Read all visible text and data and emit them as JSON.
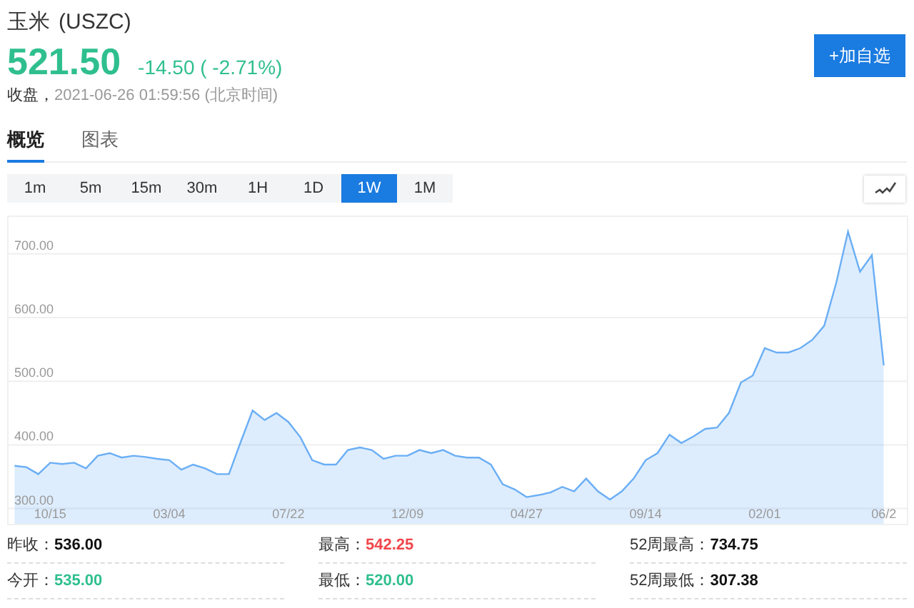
{
  "header": {
    "name": "玉米",
    "symbol": "(USZC)",
    "price": "521.50",
    "change": "-14.50 ( -2.71%)",
    "color": "#2fbf8f",
    "status": "收盘，",
    "timestamp": "2021-06-26 01:59:56 (北京时间)",
    "watchlist_button": "+加自选"
  },
  "tabs": [
    {
      "label": "概览",
      "selected": true
    },
    {
      "label": "图表",
      "selected": false
    }
  ],
  "periods": [
    {
      "label": "1m",
      "selected": false
    },
    {
      "label": "5m",
      "selected": false
    },
    {
      "label": "15m",
      "selected": false
    },
    {
      "label": "30m",
      "selected": false
    },
    {
      "label": "1H",
      "selected": false
    },
    {
      "label": "1D",
      "selected": false
    },
    {
      "label": "1W",
      "selected": true
    },
    {
      "label": "1M",
      "selected": false
    }
  ],
  "chart": {
    "chart_data": {
      "type": "area",
      "categories": [
        null,
        null,
        null,
        "10/15",
        null,
        null,
        null,
        null,
        null,
        null,
        null,
        null,
        null,
        "03/04",
        null,
        null,
        null,
        null,
        null,
        null,
        null,
        null,
        null,
        "07/22",
        null,
        null,
        null,
        null,
        null,
        null,
        null,
        null,
        null,
        "12/09",
        null,
        null,
        null,
        null,
        null,
        null,
        null,
        null,
        null,
        "04/27",
        null,
        null,
        null,
        null,
        null,
        null,
        null,
        null,
        null,
        "09/14",
        null,
        null,
        null,
        null,
        null,
        null,
        null,
        null,
        null,
        "02/01",
        null,
        null,
        null,
        null,
        null,
        null,
        null,
        null,
        null,
        "06/2"
      ],
      "series": [
        {
          "color": "#6aaef5",
          "values": [
            367,
            365,
            354,
            372,
            370,
            372,
            363,
            383,
            387,
            380,
            383,
            381,
            378,
            376,
            361,
            369,
            363,
            354,
            354,
            405,
            454,
            439,
            450,
            436,
            412,
            376,
            369,
            369,
            392,
            396,
            392,
            378,
            383,
            383,
            392,
            387,
            392,
            383,
            380,
            380,
            369,
            338,
            330,
            318,
            321,
            325,
            334,
            327,
            347,
            327,
            314,
            327,
            347,
            376,
            387,
            416,
            403,
            413,
            425,
            427,
            450,
            498,
            509,
            552,
            545,
            545,
            552,
            565,
            587,
            654,
            735,
            672,
            698,
            525
          ]
        }
      ],
      "yticks": [
        {
          "value": 300,
          "label": "300.00"
        },
        {
          "value": 400,
          "label": "400.00"
        },
        {
          "value": 500,
          "label": "500.00"
        },
        {
          "value": 600,
          "label": "600.00"
        },
        {
          "value": 700,
          "label": "700.00"
        }
      ],
      "ylim": [
        276,
        758
      ],
      "grid": true
    }
  },
  "stats": [
    {
      "label": "昨收：",
      "value": "536.00",
      "color": "#111111"
    },
    {
      "label": "最高：",
      "value": "542.25",
      "color": "#f0474b"
    },
    {
      "label": "52周最高：",
      "value": "734.75",
      "color": "#111111"
    },
    {
      "label": "今开：",
      "value": "535.00",
      "color": "#2fbf8f"
    },
    {
      "label": "最低：",
      "value": "520.00",
      "color": "#2fbf8f"
    },
    {
      "label": "52周最低：",
      "value": "307.38",
      "color": "#111111"
    }
  ]
}
